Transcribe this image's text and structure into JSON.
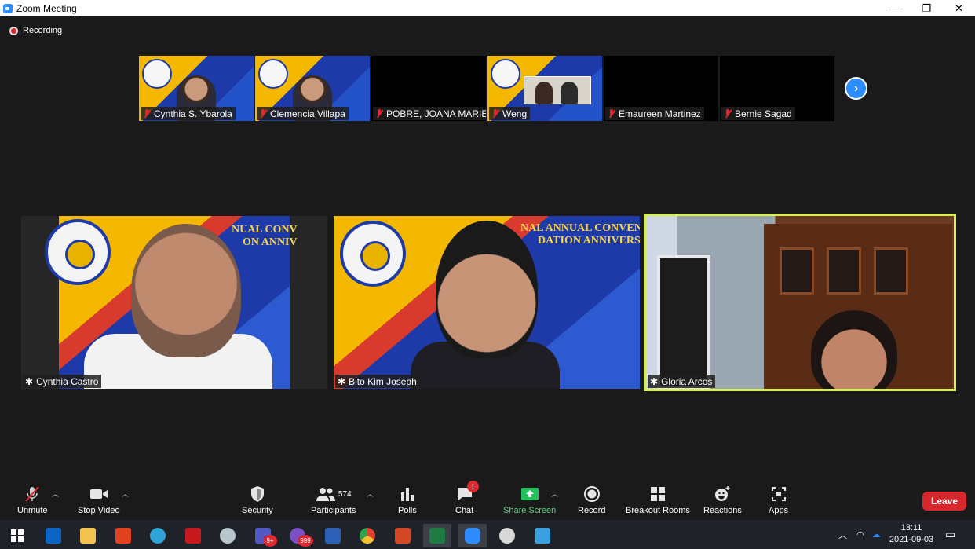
{
  "window": {
    "title": "Zoom Meeting",
    "controls": {
      "minimize": "—",
      "restore": "❐",
      "close": "✕"
    }
  },
  "recording": {
    "label": "Recording"
  },
  "thumbnails": [
    {
      "name": "Cynthia S. Ybarola",
      "muted": true,
      "video": "convention-person"
    },
    {
      "name": "Clemencia Villapa",
      "muted": true,
      "video": "convention-person"
    },
    {
      "name": "POBRE, JOANA MARIE",
      "muted": true,
      "video": "off"
    },
    {
      "name": "Weng",
      "muted": true,
      "video": "convention-inset"
    },
    {
      "name": "Emaureen Martinez",
      "muted": true,
      "video": "off"
    },
    {
      "name": "Bernie Sagad",
      "muted": true,
      "video": "off"
    }
  ],
  "main_tiles": [
    {
      "name": "Cynthia Castro",
      "pinned": true,
      "active_speaker": false,
      "banner": "NUAL CONV",
      "banner2": "ON ANNIV"
    },
    {
      "name": "Bito Kim Joseph",
      "pinned": true,
      "active_speaker": false,
      "banner": "NAL ANNUAL CONVENTION",
      "banner2": "DATION ANNIVERSARY"
    },
    {
      "name": "Gloria Arcos",
      "pinned": true,
      "active_speaker": true
    }
  ],
  "toolbar": {
    "unmute": "Unmute",
    "stop_video": "Stop Video",
    "security": "Security",
    "participants": "Participants",
    "participants_count": "574",
    "polls": "Polls",
    "chat": "Chat",
    "chat_badge": "1",
    "share_screen": "Share Screen",
    "record": "Record",
    "breakout_rooms": "Breakout Rooms",
    "reactions": "Reactions",
    "apps": "Apps",
    "leave": "Leave"
  },
  "taskbar": {
    "apps": [
      "start",
      "outlook",
      "file-explorer",
      "office",
      "network-app",
      "acrobat",
      "photo-app",
      "teams",
      "viber",
      "word",
      "chrome",
      "powerpoint",
      "excel",
      "zoom",
      "snipping",
      "photos"
    ],
    "teams_badge": "9+",
    "viber_badge": "999",
    "time": "13:11",
    "date": "2021-09-03"
  },
  "colors": {
    "accent": "#2d8cff",
    "leave": "#d8282e",
    "active_speaker": "#d6f05b",
    "muted": "#e0282e",
    "share_green": "#5bd17b"
  }
}
